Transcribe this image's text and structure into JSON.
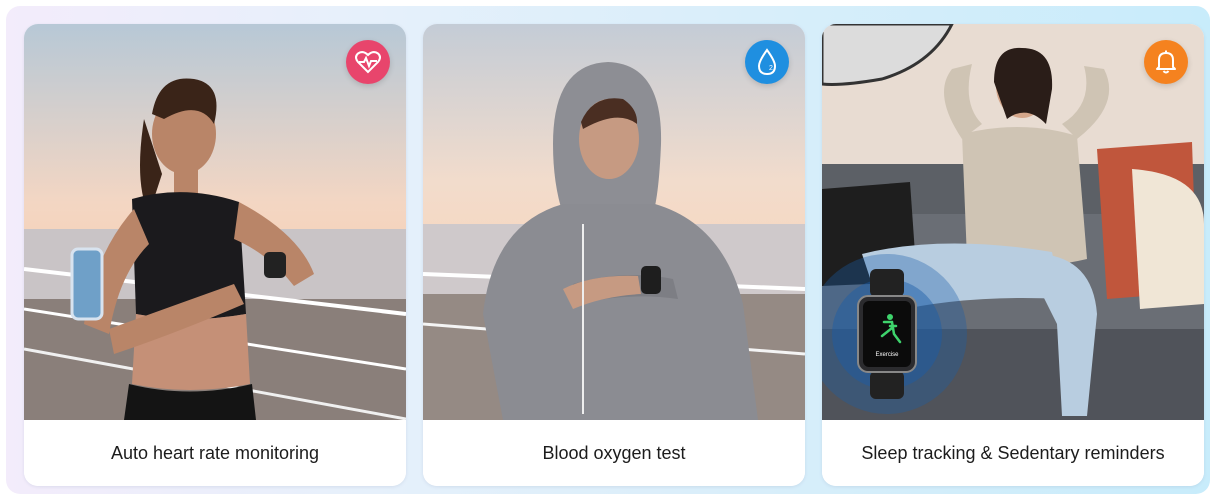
{
  "cards": [
    {
      "caption": "Auto heart rate monitoring",
      "icon": "heart-rate-icon",
      "badge_color": "#e8456c"
    },
    {
      "caption": "Blood oxygen test",
      "icon": "blood-oxygen-icon",
      "badge_color": "#1f8fe0"
    },
    {
      "caption": "Sleep tracking & Sedentary reminders",
      "icon": "bell-icon",
      "badge_color": "#f5821f"
    }
  ],
  "watch_screen_label": "Exercise"
}
